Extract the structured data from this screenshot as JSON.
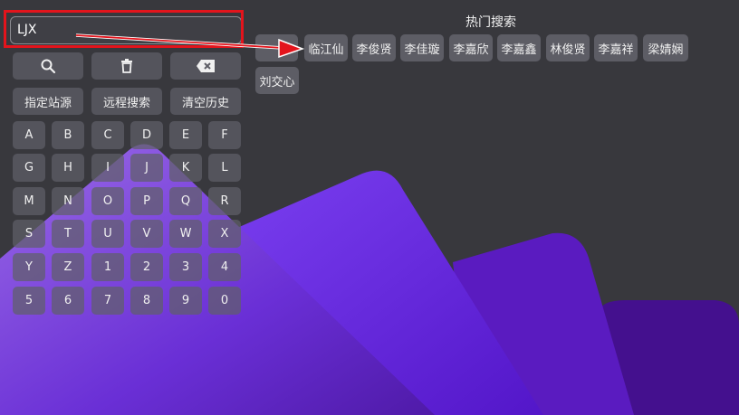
{
  "search": {
    "value": "LJX"
  },
  "toolbar": {
    "search_icon": "search-icon",
    "delete_icon": "trash-icon",
    "backspace_icon": "backspace-icon"
  },
  "actions": {
    "source": "指定站源",
    "remote": "远程搜索",
    "clear": "清空历史"
  },
  "keyboard": {
    "row1": [
      "A",
      "B",
      "C",
      "D",
      "E",
      "F"
    ],
    "row2": [
      "G",
      "H",
      "I",
      "J",
      "K",
      "L"
    ],
    "row3": [
      "M",
      "N",
      "O",
      "P",
      "Q",
      "R"
    ],
    "row4": [
      "S",
      "T",
      "U",
      "V",
      "W",
      "X"
    ],
    "row5": [
      "Y",
      "Z",
      "1",
      "2",
      "3",
      "4"
    ],
    "row6": [
      "5",
      "6",
      "7",
      "8",
      "9",
      "0"
    ]
  },
  "hot": {
    "title": "热门搜索",
    "chips": [
      "",
      "临江仙",
      "李俊贤",
      "李佳璇",
      "李嘉欣",
      "李嘉鑫",
      "林俊贤",
      "李嘉祥",
      "梁婧娴",
      "刘交心"
    ]
  },
  "colors": {
    "highlight": "#e3141c",
    "accent": "#6a1fe8"
  }
}
